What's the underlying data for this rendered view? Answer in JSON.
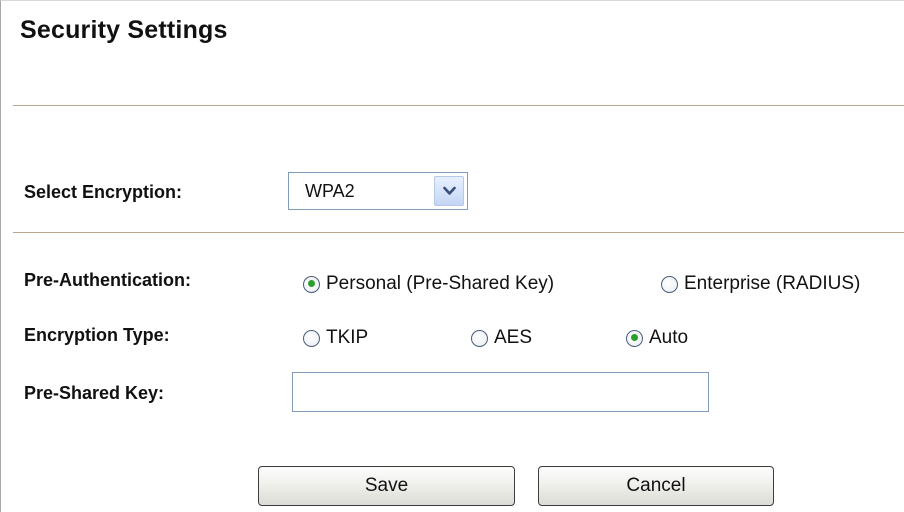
{
  "page": {
    "title": "Security Settings"
  },
  "encryption": {
    "label": "Select Encryption:",
    "selected": "WPA2",
    "dropdown_icon": "chevron-down-icon"
  },
  "pre_authentication": {
    "label": "Pre-Authentication:",
    "options": [
      {
        "label": "Personal (Pre-Shared Key)",
        "checked": true
      },
      {
        "label": "Enterprise (RADIUS)",
        "checked": false
      }
    ]
  },
  "encryption_type": {
    "label": "Encryption Type:",
    "options": [
      {
        "label": "TKIP",
        "checked": false
      },
      {
        "label": "AES",
        "checked": false
      },
      {
        "label": "Auto",
        "checked": true
      }
    ]
  },
  "pre_shared_key": {
    "label": "Pre-Shared Key:",
    "value": ""
  },
  "buttons": {
    "save_label": "Save",
    "cancel_label": "Cancel"
  },
  "colors": {
    "divider": "#b9a88f",
    "radio_checked": "#2aa02a",
    "input_border": "#7f9db9"
  }
}
